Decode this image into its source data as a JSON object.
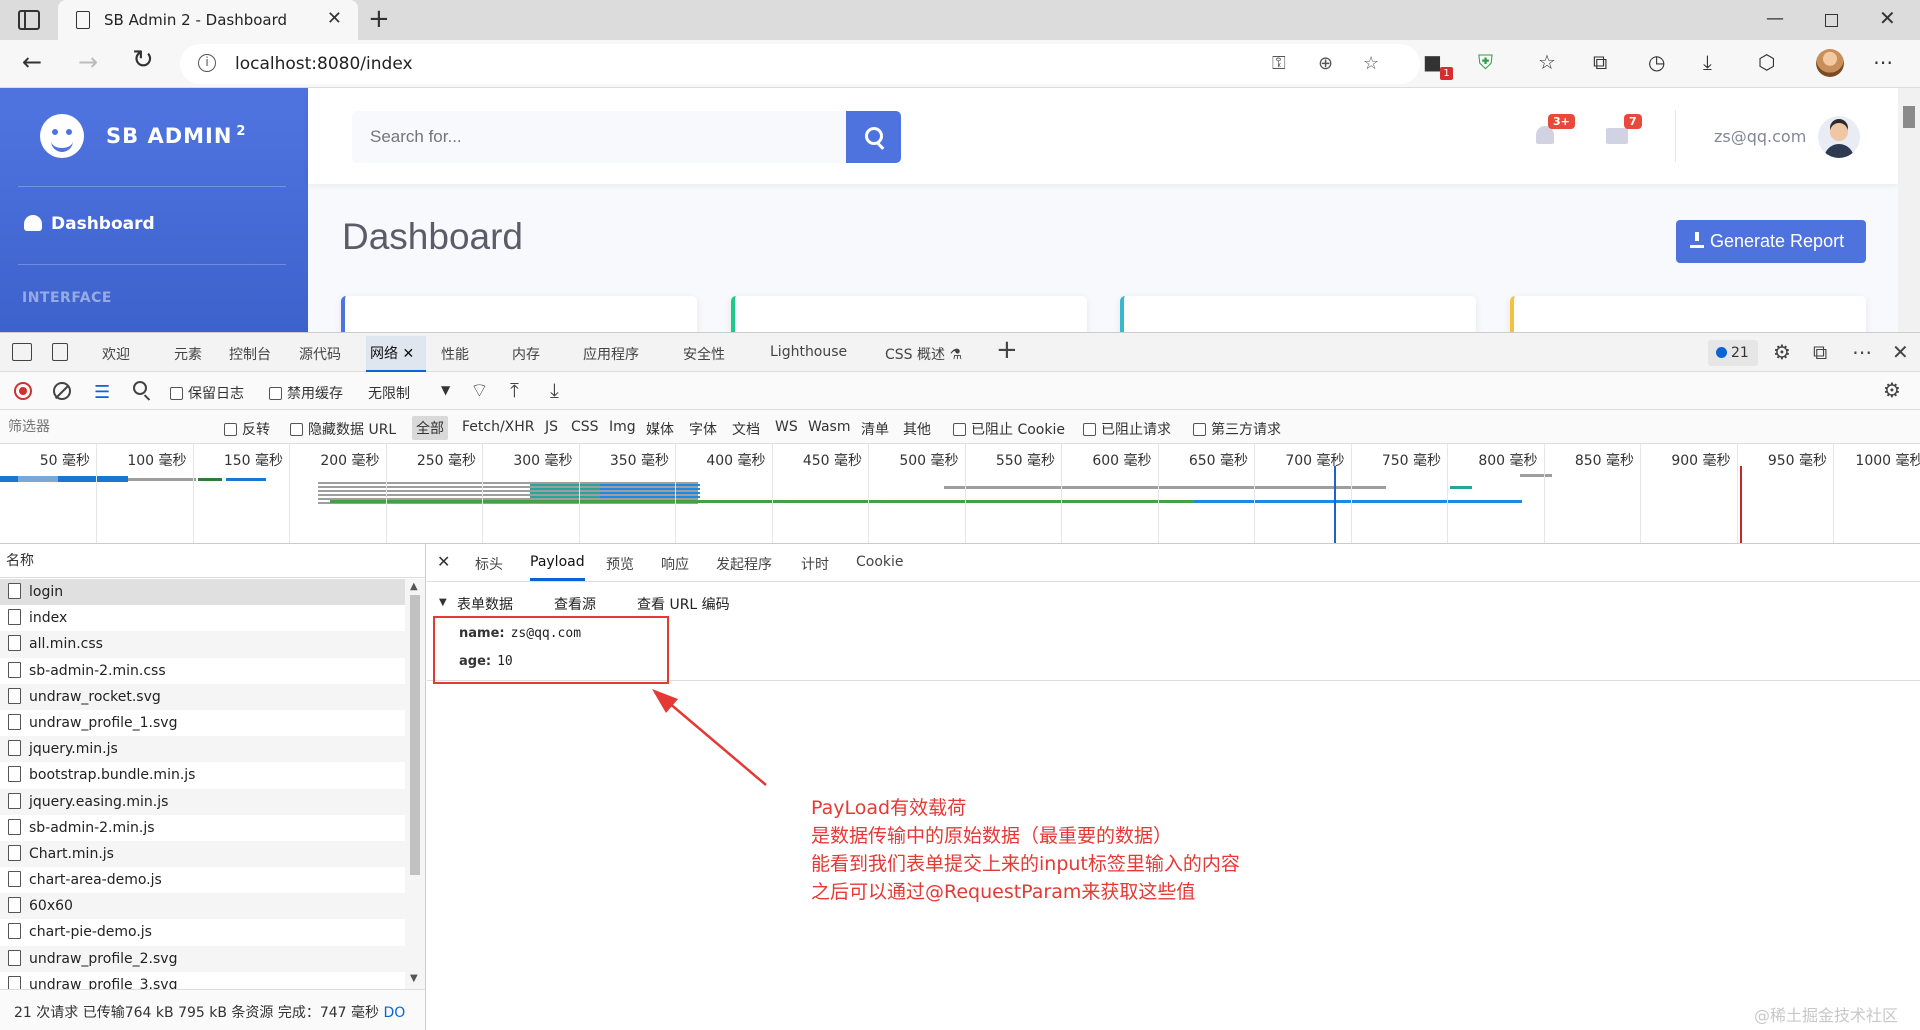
{
  "browser": {
    "tab_title": "SB Admin 2 - Dashboard",
    "url": "localhost:8080/index",
    "extension_badge": "1"
  },
  "sidebar": {
    "brand": "SB ADMIN",
    "brand_sup": "2",
    "dashboard_label": "Dashboard",
    "heading": "INTERFACE"
  },
  "topbar": {
    "search_placeholder": "Search for...",
    "alerts_badge": "3+",
    "messages_badge": "7",
    "user_name": "zs@qq.com"
  },
  "main": {
    "title": "Dashboard",
    "report_button": "Generate Report",
    "card_colors": [
      "#4e73df",
      "#1cc88a",
      "#36b9cc",
      "#f6c23e"
    ]
  },
  "devtools": {
    "tabs": [
      "欢迎",
      "元素",
      "控制台",
      "源代码",
      "网络",
      "性能",
      "内存",
      "应用程序",
      "安全性",
      "Lighthouse",
      "CSS 概述"
    ],
    "issues_count": "21",
    "toolbar": {
      "preserve_log": "保留日志",
      "disable_cache": "禁用缓存",
      "throttle": "无限制"
    },
    "filter": {
      "placeholder": "筛选器",
      "invert": "反转",
      "hide_data_url": "隐藏数据 URL",
      "types": [
        "全部",
        "Fetch/XHR",
        "JS",
        "CSS",
        "Img",
        "媒体",
        "字体",
        "文档",
        "WS",
        "Wasm",
        "清单",
        "其他"
      ],
      "blocked_cookies": "已阻止 Cookie",
      "blocked_requests": "已阻止请求",
      "third_party": "第三方请求"
    },
    "timeline_ticks": [
      "50 毫秒",
      "100 毫秒",
      "150 毫秒",
      "200 毫秒",
      "250 毫秒",
      "300 毫秒",
      "350 毫秒",
      "400 毫秒",
      "450 毫秒",
      "500 毫秒",
      "550 毫秒",
      "600 毫秒",
      "650 毫秒",
      "700 毫秒",
      "750 毫秒",
      "800 毫秒",
      "850 毫秒",
      "900 毫秒",
      "950 毫秒",
      "1000 毫秒"
    ],
    "name_header": "名称",
    "requests": [
      "login",
      "index",
      "all.min.css",
      "sb-admin-2.min.css",
      "undraw_rocket.svg",
      "undraw_profile_1.svg",
      "jquery.min.js",
      "bootstrap.bundle.min.js",
      "jquery.easing.min.js",
      "sb-admin-2.min.js",
      "Chart.min.js",
      "chart-area-demo.js",
      "60x60",
      "chart-pie-demo.js",
      "undraw_profile_2.svg",
      "undraw_profile_3.svg"
    ],
    "detail_tabs": [
      "标头",
      "Payload",
      "预览",
      "响应",
      "发起程序",
      "计时",
      "Cookie"
    ],
    "form_data": {
      "heading": "表单数据",
      "view_source": "查看源",
      "view_url_encoded": "查看 URL 编码",
      "fields": [
        {
          "key": "name:",
          "value": "zs@qq.com"
        },
        {
          "key": "age:",
          "value": "10"
        }
      ]
    },
    "status": {
      "requests": "21 次请求",
      "transferred": "已传输764 kB",
      "resources": "795 kB 条资源",
      "finish": "完成：747 毫秒",
      "dom": "DO"
    }
  },
  "annotation": {
    "lines": [
      "PayLoad有效载荷",
      "是数据传输中的原始数据（最重要的数据）",
      "能看到我们表单提交上来的input标签里输入的内容",
      "之后可以通过@RequestParam来获取这些值"
    ]
  },
  "watermark": "@稀土掘金技术社区"
}
